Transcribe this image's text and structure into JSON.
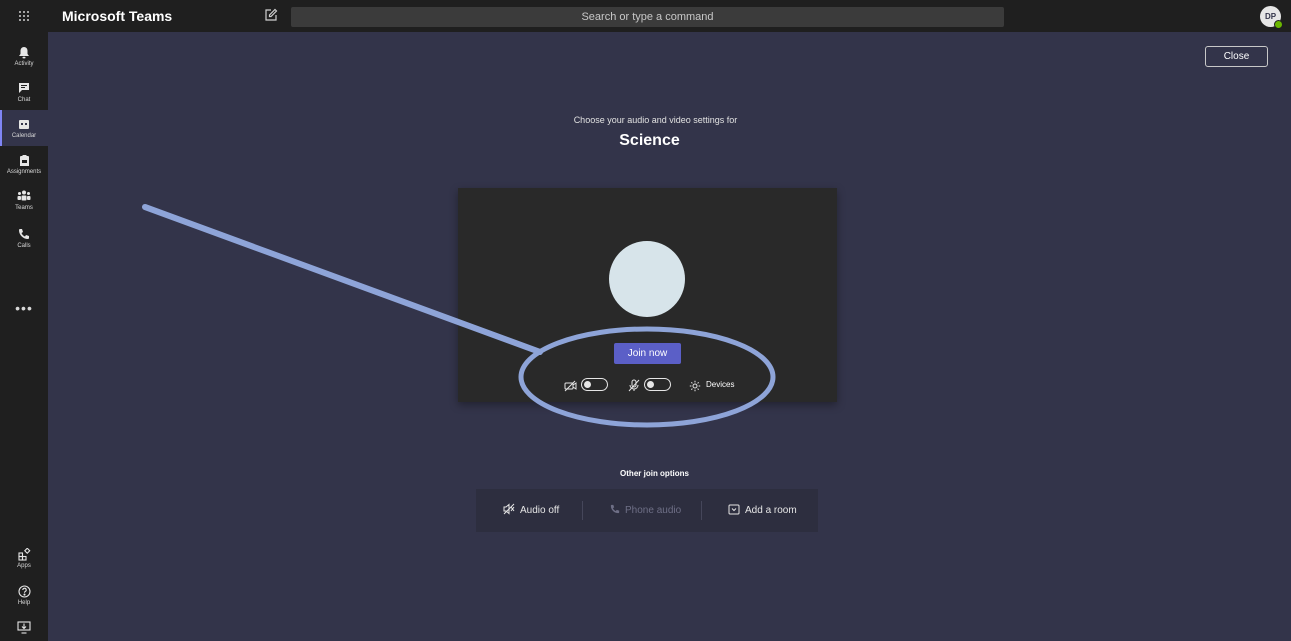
{
  "app": {
    "title": "Microsoft Teams"
  },
  "search": {
    "placeholder": "Search or type a command"
  },
  "user": {
    "initials": "DP",
    "status_color": "#6bb700"
  },
  "rail": {
    "items": [
      {
        "label": "Activity",
        "icon": "bell-icon"
      },
      {
        "label": "Chat",
        "icon": "chat-icon"
      },
      {
        "label": "Calendar",
        "icon": "calendar-icon",
        "active": true
      },
      {
        "label": "Assignments",
        "icon": "backpack-icon"
      },
      {
        "label": "Teams",
        "icon": "teams-icon"
      },
      {
        "label": "Calls",
        "icon": "phone-icon"
      }
    ],
    "more": "•••",
    "bottom": [
      {
        "label": "Apps",
        "icon": "apps-icon"
      },
      {
        "label": "Help",
        "icon": "help-icon"
      }
    ]
  },
  "header": {
    "close_label": "Close"
  },
  "prejoin": {
    "subtitle": "Choose your audio and video settings for",
    "meeting_name": "Science",
    "join_label": "Join now",
    "camera_on": false,
    "mic_on": false,
    "devices_label": "Devices"
  },
  "other_options": {
    "title": "Other join options",
    "items": [
      {
        "label": "Audio off",
        "icon": "speaker-off-icon",
        "enabled": true
      },
      {
        "label": "Phone audio",
        "icon": "phone-icon",
        "enabled": false
      },
      {
        "label": "Add a room",
        "icon": "cast-icon",
        "enabled": true
      }
    ]
  },
  "colors": {
    "accent": "#5b5fc7",
    "background": "#33344a",
    "rail": "#1f1f1f",
    "annotation": "#8ea4d8"
  }
}
